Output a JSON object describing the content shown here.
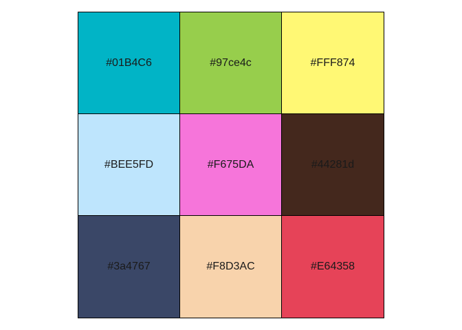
{
  "swatches": [
    {
      "label": "#01B4C6",
      "color": "#01B4C6"
    },
    {
      "label": "#97ce4c",
      "color": "#97ce4c"
    },
    {
      "label": "#FFF874",
      "color": "#FFF874"
    },
    {
      "label": "#BEE5FD",
      "color": "#BEE5FD"
    },
    {
      "label": "#F675DA",
      "color": "#F675DA"
    },
    {
      "label": "#44281d",
      "color": "#44281d"
    },
    {
      "label": "#3a4767",
      "color": "#3a4767"
    },
    {
      "label": "#F8D3AC",
      "color": "#F8D3AC"
    },
    {
      "label": "#E64358",
      "color": "#E64358"
    }
  ]
}
